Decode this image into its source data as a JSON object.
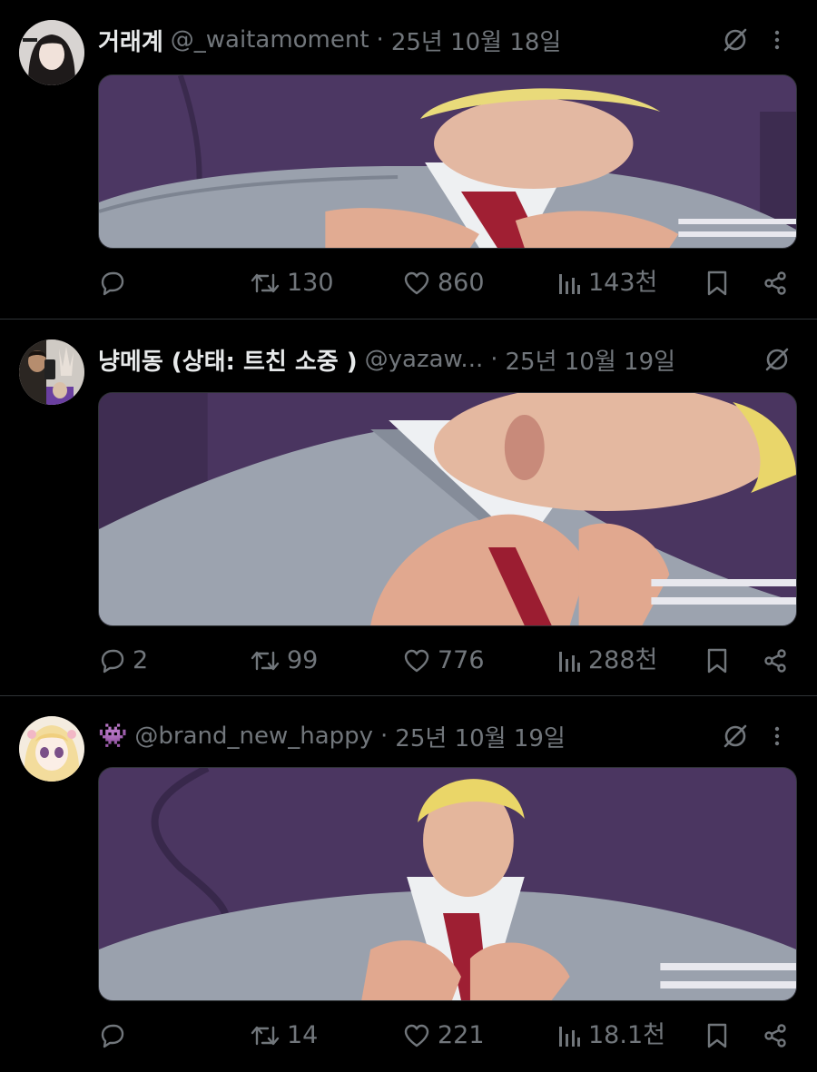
{
  "tweets": [
    {
      "display_name": "거래계",
      "handle": "@_waitamoment",
      "separator": "·",
      "date": "25년 10월 18일",
      "counts": {
        "reply": "",
        "retweet": "130",
        "like": "860",
        "views": "143천"
      }
    },
    {
      "display_name": "냥메동 (상태: 트친 소중 )",
      "handle": "@yazaw...",
      "separator": "·",
      "date": "25년 10월 19일",
      "counts": {
        "reply": "2",
        "retweet": "99",
        "like": "776",
        "views": "288천"
      }
    },
    {
      "display_name": "👾",
      "handle": "@brand_new_happy",
      "separator": "·",
      "date": "25년 10월 19일",
      "counts": {
        "reply": "",
        "retweet": "14",
        "like": "221",
        "views": "18.1천"
      }
    }
  ],
  "colors": {
    "background": "#000000",
    "text_primary": "#e7e9ea",
    "text_secondary": "#71767b",
    "divider": "#2f3336",
    "media_backdrop": "#4a3560"
  },
  "icons": {
    "header": [
      "grok-slash-icon",
      "more-vertical-icon"
    ],
    "actions": [
      "reply-icon",
      "retweet-icon",
      "like-heart-icon",
      "views-chart-icon",
      "bookmark-icon",
      "share-icon"
    ]
  }
}
